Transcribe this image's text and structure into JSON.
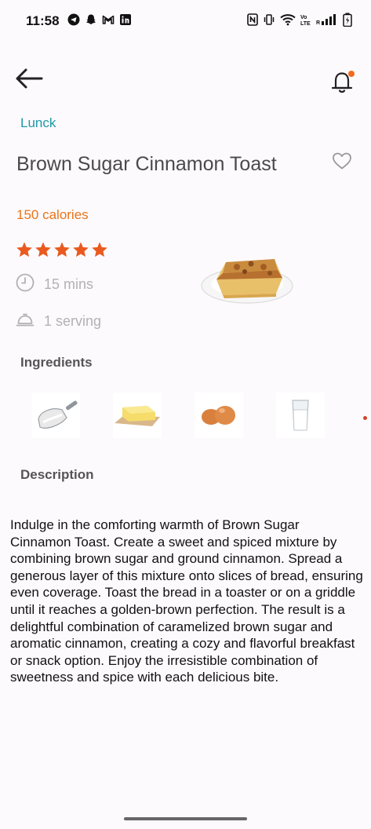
{
  "status_bar": {
    "time": "11:58",
    "notification_icons": [
      "telegram-icon",
      "snapchat-icon",
      "gmail-icon",
      "linkedin-icon"
    ],
    "system_icons": [
      "nfc-icon",
      "vibrate-icon",
      "wifi-icon",
      "volte-icon",
      "signal-icon",
      "battery-icon"
    ]
  },
  "header": {
    "back_icon": "arrow-left-icon",
    "bell_icon": "bell-icon",
    "notification_dot_color": "#f26a1b"
  },
  "recipe": {
    "category": "Lunck",
    "title": "Brown Sugar Cinnamon Toast",
    "calories": "150 calories",
    "rating": 5,
    "rating_max": 5,
    "time": "15 mins",
    "serving": "1 serving",
    "image": "brown-sugar-cinnamon-toast-photo"
  },
  "ingredients": {
    "heading": "Ingredients",
    "items": [
      "sugar-scoop-image",
      "butter-image",
      "eggs-image",
      "milk-glass-image"
    ]
  },
  "description": {
    "heading": "Description",
    "text": "Indulge in the comforting warmth of Brown Sugar Cinnamon Toast. Create a sweet and spiced mixture by combining brown sugar and ground cinnamon. Spread a generous layer of this mixture onto slices of bread, ensuring even coverage. Toast the bread in a toaster or on a griddle until it reaches a golden-brown perfection. The result is a delightful combination of caramelized brown sugar and aromatic cinnamon, creating a cozy and flavorful breakfast or snack option. Enjoy the irresistible combination of sweetness and spice with each delicious bite."
  },
  "colors": {
    "accent_teal": "#1b99a6",
    "accent_orange": "#e8751a",
    "star_color": "#ea5a1e",
    "muted": "#b2b2b2"
  }
}
